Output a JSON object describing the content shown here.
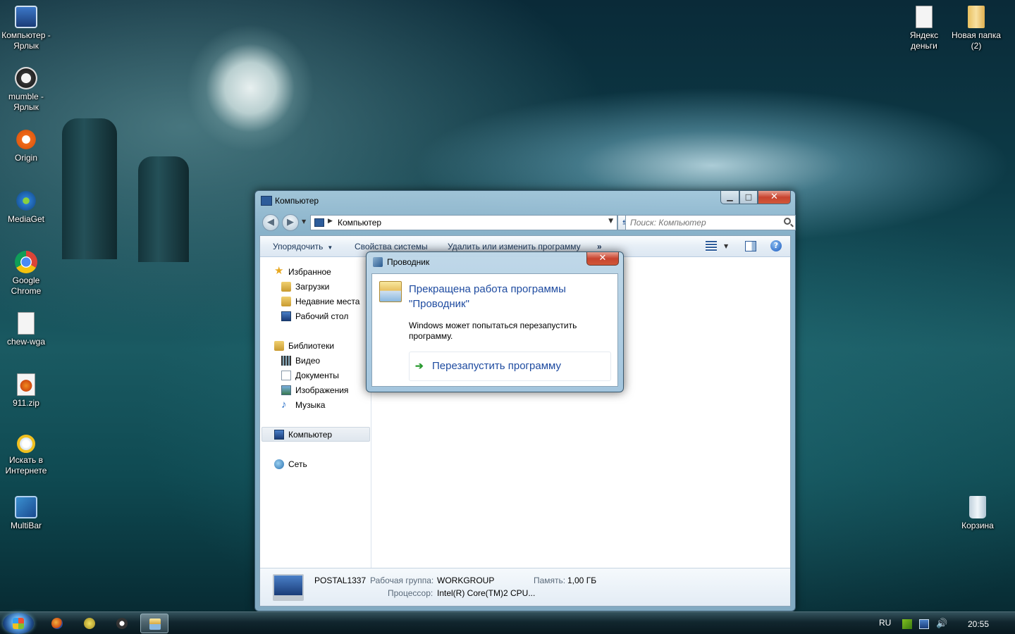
{
  "desktop": {
    "icons_left": [
      {
        "label": "Компьютер - Ярлык",
        "icon": "computer-shortcut-icon"
      },
      {
        "label": "mumble - Ярлык",
        "icon": "mumble-icon"
      },
      {
        "label": "Origin",
        "icon": "origin-icon"
      },
      {
        "label": "MediaGet",
        "icon": "mediaget-icon"
      },
      {
        "label": "Google Chrome",
        "icon": "chrome-icon"
      },
      {
        "label": "chew-wga",
        "icon": "file-icon"
      },
      {
        "label": "911.zip",
        "icon": "firefox-file-icon"
      },
      {
        "label": "Искать в Интернете",
        "icon": "search-web-icon"
      },
      {
        "label": "MultiBar",
        "icon": "multibar-icon"
      }
    ],
    "icons_right": [
      {
        "label": "Яндекс деньги",
        "icon": "file-icon"
      },
      {
        "label": "Новая папка (2)",
        "icon": "folder-icon"
      },
      {
        "label": "Корзина",
        "icon": "recycle-bin-icon"
      }
    ]
  },
  "explorer": {
    "title": "Компьютер",
    "address": "Компьютер",
    "search_placeholder": "Поиск: Компьютер",
    "commands": {
      "organize": "Упорядочить",
      "system_properties": "Свойства системы",
      "uninstall": "Удалить или изменить программу",
      "more": "»"
    },
    "nav": {
      "favorites": "Избранное",
      "downloads": "Загрузки",
      "recent": "Недавние места",
      "desktop": "Рабочий стол",
      "libraries": "Библиотеки",
      "video": "Видео",
      "documents": "Документы",
      "images": "Изображения",
      "music": "Музыка",
      "computer": "Компьютер",
      "network": "Сеть"
    },
    "details": {
      "name": "POSTAL1337",
      "workgroup_label": "Рабочая группа:",
      "workgroup_value": "WORKGROUP",
      "memory_label": "Память:",
      "memory_value": "1,00 ГБ",
      "cpu_label": "Процессор:",
      "cpu_value": "Intel(R) Core(TM)2 CPU..."
    }
  },
  "dialog": {
    "title": "Проводник",
    "heading": "Прекращена работа программы \"Проводник\"",
    "text": "Windows может попытаться перезапустить программу.",
    "action": "Перезапустить программу",
    "close": "✕"
  },
  "taskbar": {
    "language": "RU",
    "time": "20:55"
  }
}
